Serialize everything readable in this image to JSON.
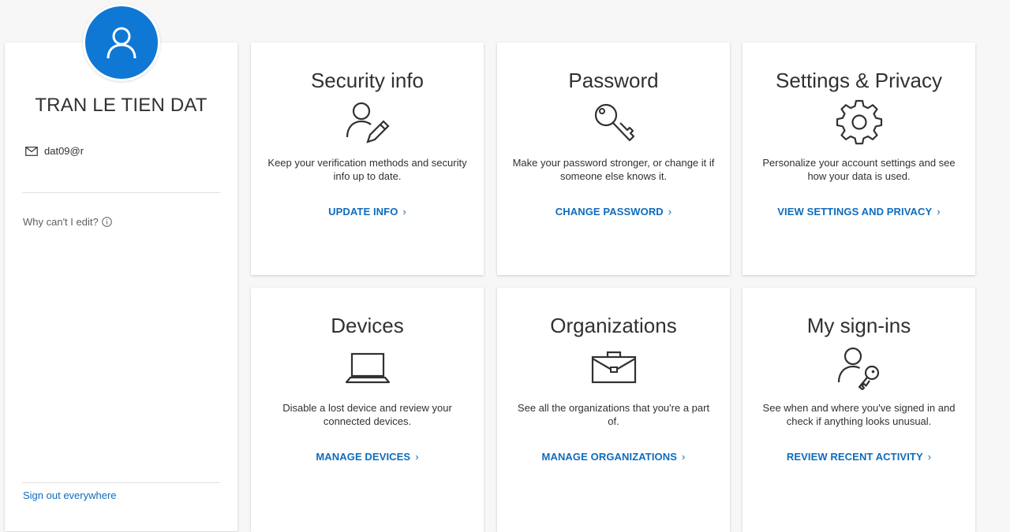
{
  "profile": {
    "name": "TRAN LE TIEN DAT",
    "email": "dat09@r",
    "why_edit": "Why can't I edit?",
    "sign_out": "Sign out everywhere"
  },
  "tiles": [
    {
      "title": "Security info",
      "icon": "user-pen-icon",
      "desc": "Keep your verification methods and security info up to date.",
      "link": "UPDATE INFO"
    },
    {
      "title": "Password",
      "icon": "key-icon",
      "desc": "Make your password stronger, or change it if someone else knows it.",
      "link": "CHANGE PASSWORD"
    },
    {
      "title": "Settings & Privacy",
      "icon": "gear-icon",
      "desc": "Personalize your account settings and see how your data is used.",
      "link": "VIEW SETTINGS AND PRIVACY"
    },
    {
      "title": "Devices",
      "icon": "laptop-icon",
      "desc": "Disable a lost device and review your connected devices.",
      "link": "MANAGE DEVICES"
    },
    {
      "title": "Organizations",
      "icon": "briefcase-icon",
      "desc": "See all the organizations that you're a part of.",
      "link": "MANAGE ORGANIZATIONS"
    },
    {
      "title": "My sign-ins",
      "icon": "user-key-icon",
      "desc": "See when and where you've signed in and check if anything looks unusual.",
      "link": "REVIEW RECENT ACTIVITY"
    }
  ],
  "colors": {
    "accent": "#0f6cbd",
    "avatar_bg": "#0f78d4",
    "page_bg": "#f7f7f7"
  }
}
